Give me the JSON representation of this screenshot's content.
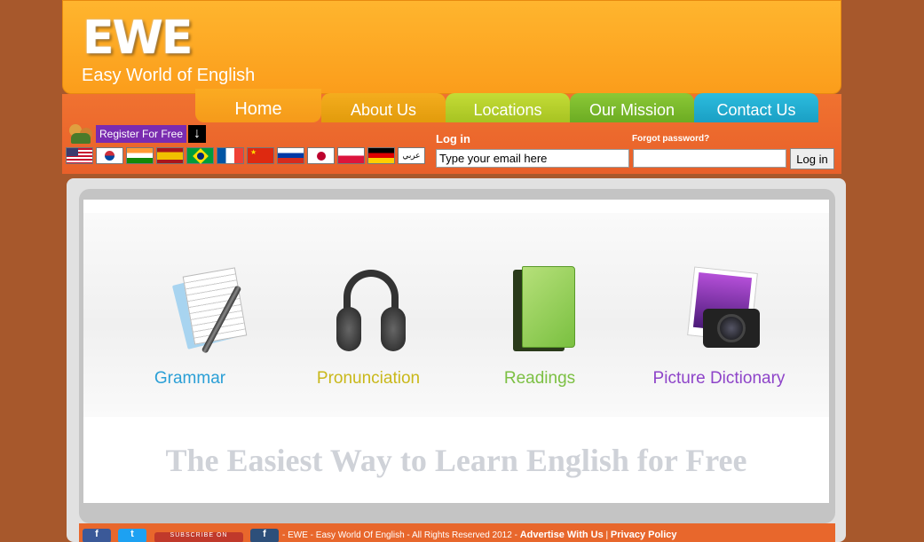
{
  "brand": {
    "logo": "EWE",
    "tagline": "Easy World of English"
  },
  "nav": {
    "tabs": [
      {
        "label": "Home"
      },
      {
        "label": "About Us"
      },
      {
        "label": "Locations"
      },
      {
        "label": "Our Mission"
      },
      {
        "label": "Contact Us"
      }
    ]
  },
  "register": {
    "label": "Register For Free"
  },
  "flags": [
    "us",
    "kr",
    "in",
    "es",
    "br",
    "fr",
    "cn",
    "ru",
    "jp",
    "pl",
    "de",
    "ar"
  ],
  "flag_ar_text": "عربي",
  "login": {
    "title": "Log in",
    "forgot": "Forgot password?",
    "email_placeholder": "Type your email here",
    "button": "Log in"
  },
  "features": [
    {
      "label": "Grammar",
      "color": "#2a9fd6"
    },
    {
      "label": "Pronunciation",
      "color": "#c9b81a"
    },
    {
      "label": "Readings",
      "color": "#7cc043"
    },
    {
      "label": "Picture Dictionary",
      "color": "#8e44c9"
    }
  ],
  "headline": "The Easiest Way to Learn English for Free",
  "footer": {
    "copyright": "- EWE - Easy World Of English - All Rights Reserved 2012 -",
    "advertise": "Advertise With Us",
    "separator": "|",
    "privacy": "Privacy Policy",
    "subscribe": "SUBSCRIBE ON"
  }
}
